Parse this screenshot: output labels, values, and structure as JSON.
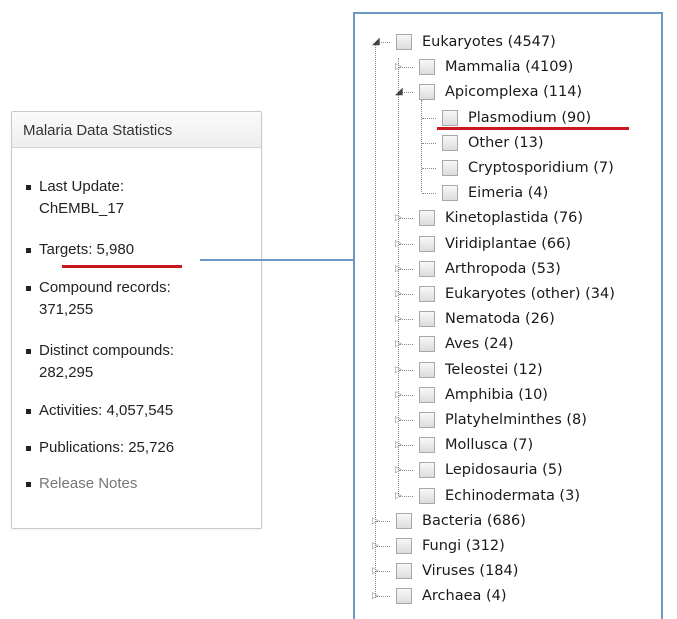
{
  "stats_panel": {
    "title": "Malaria Data Statistics",
    "items": [
      {
        "line1": "Last Update:",
        "line2": "ChEMBL_17"
      },
      {
        "line1": "Targets: 5,980"
      },
      {
        "line1": "Compound records:",
        "line2": "371,255"
      },
      {
        "line1": "Distinct compounds:",
        "line2": "282,295"
      },
      {
        "line1": "Activities: 4,057,545"
      },
      {
        "line1": "Publications: 25,726"
      },
      {
        "line1": "Release Notes"
      }
    ]
  },
  "tree": {
    "nodes": [
      {
        "label": "Eukaryotes (4547)",
        "level": 0,
        "expanded": true
      },
      {
        "label": "Mammalia (4109)",
        "level": 1,
        "expanded": false
      },
      {
        "label": "Apicomplexa (114)",
        "level": 1,
        "expanded": true
      },
      {
        "label": "Plasmodium (90)",
        "level": 2
      },
      {
        "label": "Other (13)",
        "level": 2
      },
      {
        "label": "Cryptosporidium (7)",
        "level": 2
      },
      {
        "label": "Eimeria (4)",
        "level": 2
      },
      {
        "label": "Kinetoplastida (76)",
        "level": 1,
        "expanded": false
      },
      {
        "label": "Viridiplantae (66)",
        "level": 1,
        "expanded": false
      },
      {
        "label": "Arthropoda (53)",
        "level": 1,
        "expanded": false
      },
      {
        "label": "Eukaryotes (other) (34)",
        "level": 1,
        "expanded": false
      },
      {
        "label": "Nematoda (26)",
        "level": 1,
        "expanded": false
      },
      {
        "label": "Aves (24)",
        "level": 1,
        "expanded": false
      },
      {
        "label": "Teleostei (12)",
        "level": 1,
        "expanded": false
      },
      {
        "label": "Amphibia (10)",
        "level": 1,
        "expanded": false
      },
      {
        "label": "Platyhelminthes (8)",
        "level": 1,
        "expanded": false
      },
      {
        "label": "Mollusca (7)",
        "level": 1,
        "expanded": false
      },
      {
        "label": "Lepidosauria (5)",
        "level": 1,
        "expanded": false
      },
      {
        "label": "Echinodermata (3)",
        "level": 1,
        "expanded": false
      },
      {
        "label": "Bacteria (686)",
        "level": 0,
        "expanded": false
      },
      {
        "label": "Fungi (312)",
        "level": 0,
        "expanded": false
      },
      {
        "label": "Viruses (184)",
        "level": 0,
        "expanded": false
      },
      {
        "label": "Archaea (4)",
        "level": 0,
        "expanded": false
      }
    ]
  },
  "colors": {
    "highlight_underline": "#c8171f",
    "connector": "#6b98c4"
  },
  "icons": {
    "expanded": "triangle-down-icon",
    "collapsed": "triangle-right-icon"
  }
}
